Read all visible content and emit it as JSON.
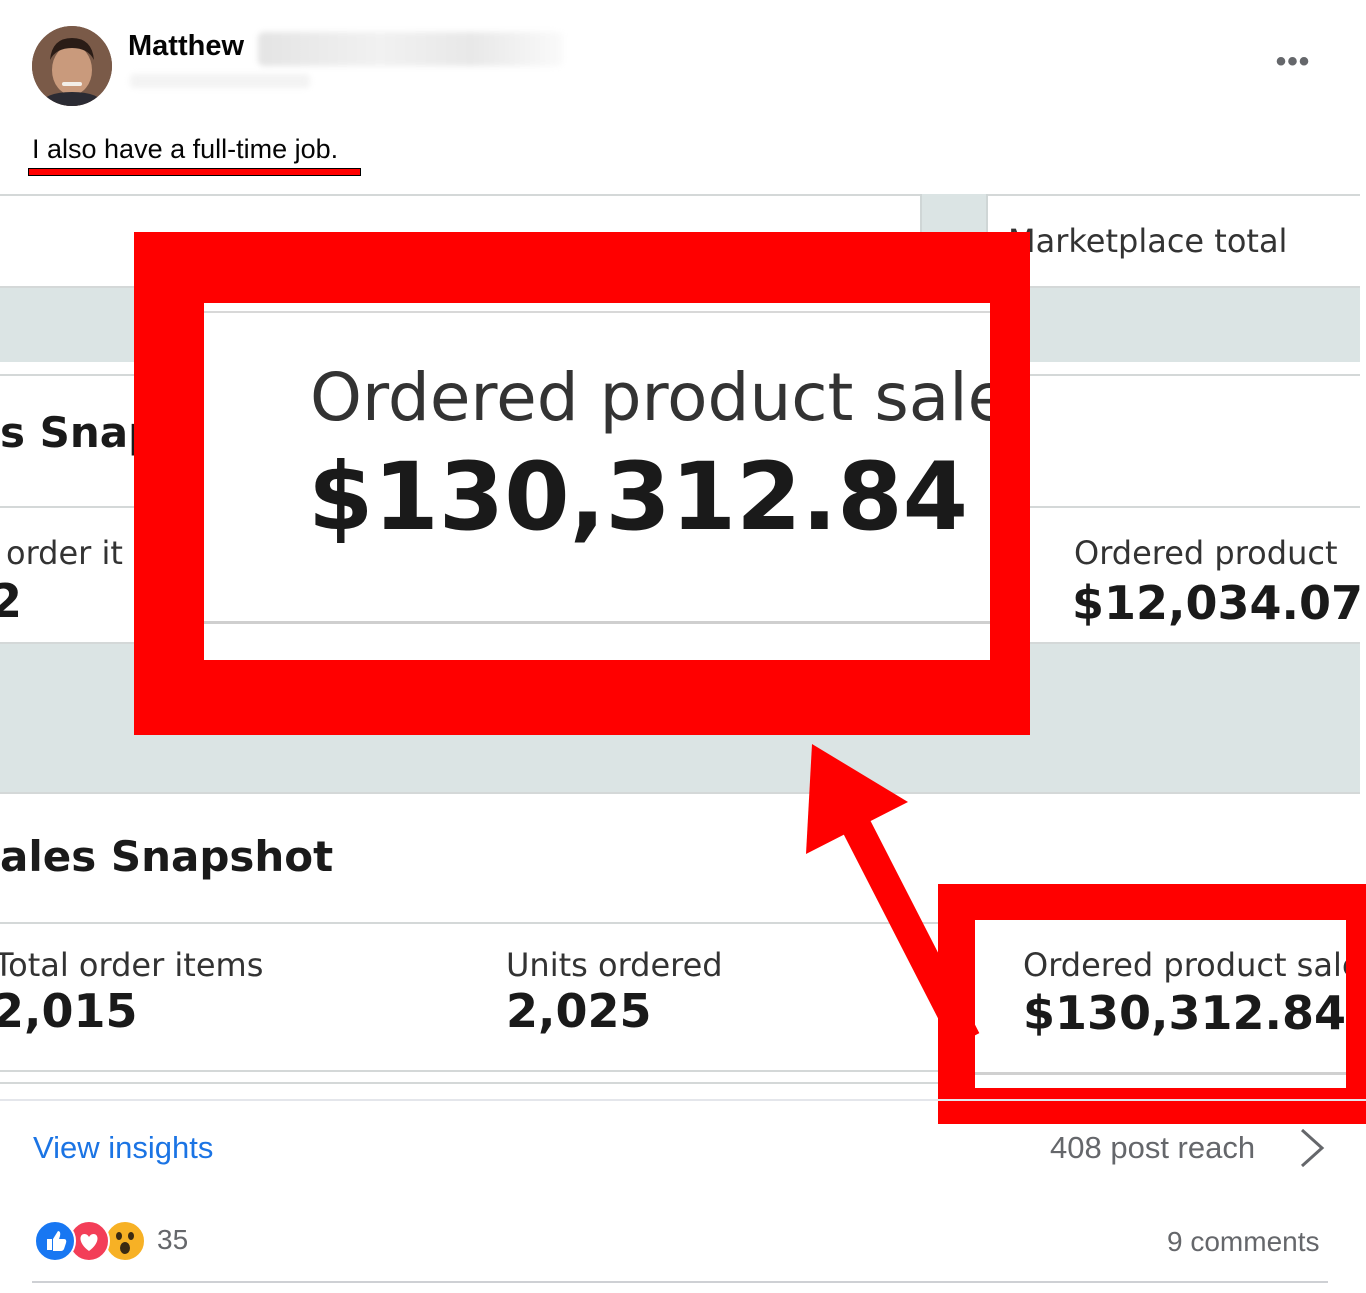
{
  "post": {
    "author": "Matthew",
    "text": "I also have a full-time job.",
    "more_icon": "•••"
  },
  "screenshot": {
    "marketplace_header": "Marketplace total",
    "snapshot_top_partial": "s Snap",
    "order_items_partial": "order it",
    "order_items_value_partial": "2",
    "right_label": "Ordered product",
    "right_value": "$12,034.07",
    "snapshot_heading": "ales Snapshot",
    "total_order_items_label": "Total order items",
    "total_order_items_value": "2,015",
    "units_ordered_label": "Units ordered",
    "units_ordered_value": "2,025",
    "ordered_sales_label": "Ordered product sale",
    "ordered_sales_value": "$130,312.84"
  },
  "zoom": {
    "label": "Ordered product sale",
    "value": "$130,312.84"
  },
  "footer": {
    "view_insights": "View insights",
    "post_reach": "408 post reach",
    "reaction_count": "35",
    "comments": "9 comments"
  },
  "colors": {
    "highlight": "#ff0000",
    "link": "#1b74e4",
    "like": "#1877f2",
    "love": "#f33e58",
    "wow": "#f7b125"
  }
}
